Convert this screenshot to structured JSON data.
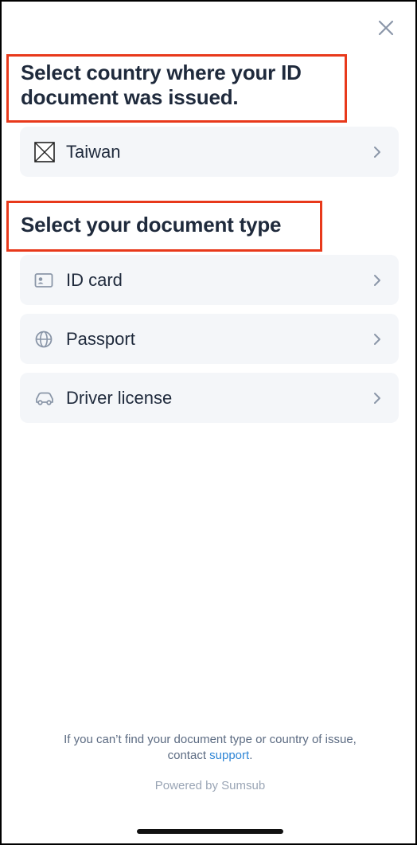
{
  "header": {
    "close_icon": "close-icon"
  },
  "country_section": {
    "title": "Select country where your ID document was issued.",
    "selected_country": "Taiwan",
    "flag_icon": "flag-placeholder-icon"
  },
  "document_section": {
    "title": "Select your document type",
    "items": [
      {
        "label": "ID card",
        "icon": "id-card-icon"
      },
      {
        "label": "Passport",
        "icon": "globe-icon"
      },
      {
        "label": "Driver license",
        "icon": "car-icon"
      }
    ]
  },
  "footer": {
    "note_prefix": "If you can’t find your document type or country of issue,",
    "note_contact": "contact",
    "support_link": "support",
    "note_suffix": ".",
    "powered_by": "Powered by Sumsub"
  },
  "colors": {
    "annotation": "#e8391b",
    "card_bg": "#f4f6f9",
    "link": "#2f86d6",
    "text": "#1f2a3c"
  }
}
